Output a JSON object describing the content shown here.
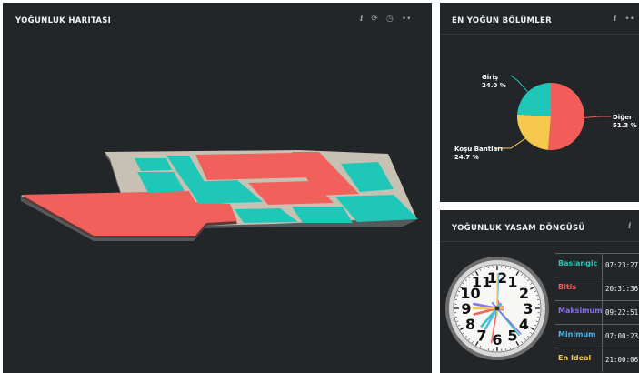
{
  "density_map": {
    "title": "YOĞUNLUK HARITASI",
    "icons": [
      "info-icon",
      "refresh-icon",
      "clock-icon",
      "more-icon"
    ]
  },
  "busiest": {
    "title": "EN YOĞUN BÖLÜMLER",
    "chart_data": {
      "type": "pie",
      "slices": [
        {
          "label": "Diğer",
          "value": 51.3,
          "text": "51.3 %",
          "color": "#f25d5a"
        },
        {
          "label": "Koşu Bantları",
          "value": 24.7,
          "text": "24.7 %",
          "color": "#f6c94c"
        },
        {
          "label": "Giriş",
          "value": 24.0,
          "text": "24.0 %",
          "color": "#1fc7b8"
        }
      ]
    }
  },
  "lifecycle": {
    "title": "YOĞUNLUK YASAM DÖNGÜSÜ",
    "rows": [
      {
        "label": "Baslangic",
        "time": "07:23:27",
        "color": "#27c6b5"
      },
      {
        "label": "Bitis",
        "time": "20:31:36",
        "color": "#f25d5a"
      },
      {
        "label": "Maksimum",
        "time": "09:22:51",
        "color": "#8b6cf0"
      },
      {
        "label": "Minimum",
        "time": "07:00:23",
        "color": "#4fb4ee"
      },
      {
        "label": "En Ideal",
        "time": "21:00:06",
        "color": "#f6c94c"
      }
    ],
    "clock_numerals": [
      "12",
      "1",
      "2",
      "3",
      "4",
      "5",
      "6",
      "7",
      "8",
      "9",
      "10",
      "11"
    ]
  }
}
